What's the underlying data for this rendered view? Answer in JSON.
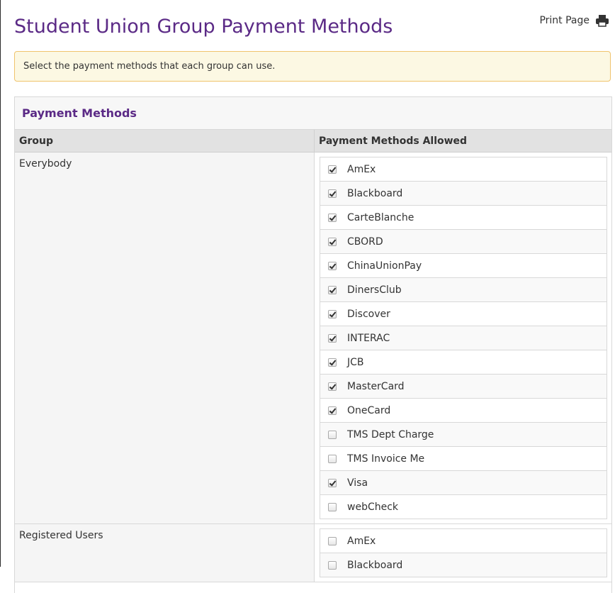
{
  "page": {
    "title": "Student Union Group Payment Methods",
    "print_label": "Print Page",
    "print_icon": "printer-icon",
    "notice": "Select the payment methods that each group can use."
  },
  "panel": {
    "title": "Payment Methods",
    "columns": {
      "group": "Group",
      "methods": "Payment Methods Allowed"
    }
  },
  "groups": [
    {
      "name": "Everybody",
      "methods": [
        {
          "label": "AmEx",
          "checked": true
        },
        {
          "label": "Blackboard",
          "checked": true
        },
        {
          "label": "CarteBlanche",
          "checked": true
        },
        {
          "label": "CBORD",
          "checked": true
        },
        {
          "label": "ChinaUnionPay",
          "checked": true
        },
        {
          "label": "DinersClub",
          "checked": true
        },
        {
          "label": "Discover",
          "checked": true
        },
        {
          "label": "INTERAC",
          "checked": true
        },
        {
          "label": "JCB",
          "checked": true
        },
        {
          "label": "MasterCard",
          "checked": true
        },
        {
          "label": "OneCard",
          "checked": true
        },
        {
          "label": "TMS Dept Charge",
          "checked": false
        },
        {
          "label": "TMS Invoice Me",
          "checked": false
        },
        {
          "label": "Visa",
          "checked": true
        },
        {
          "label": "webCheck",
          "checked": false
        }
      ]
    },
    {
      "name": "Registered Users",
      "methods": [
        {
          "label": "AmEx",
          "checked": false
        },
        {
          "label": "Blackboard",
          "checked": false
        }
      ]
    }
  ],
  "colors": {
    "title": "#5b2a86",
    "notice_bg": "#fcf8e3",
    "notice_border": "#f0c36d"
  }
}
